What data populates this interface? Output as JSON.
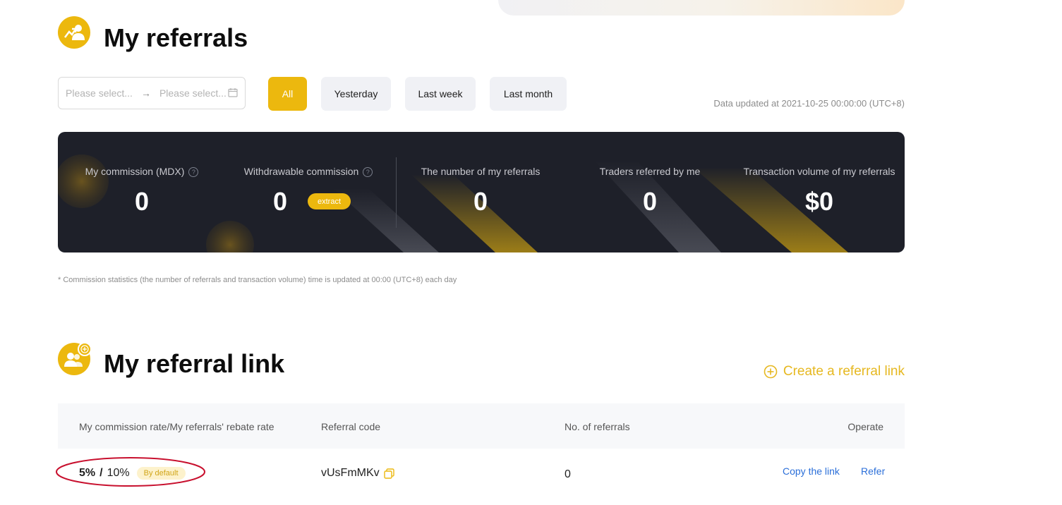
{
  "referrals": {
    "title": "My referrals",
    "date_start_placeholder": "Please select...",
    "date_end_placeholder": "Please select...",
    "arrow": "→",
    "filters": [
      {
        "label": "All",
        "active": true
      },
      {
        "label": "Yesterday",
        "active": false
      },
      {
        "label": "Last week",
        "active": false
      },
      {
        "label": "Last month",
        "active": false
      }
    ],
    "updated_text": "Data updated at 2021-10-25 00:00:00 (UTC+8)"
  },
  "stats": {
    "commission_label": "My commission (MDX)",
    "commission_value": "0",
    "withdrawable_label": "Withdrawable commission",
    "withdrawable_value": "0",
    "extract_label": "extract",
    "referrals_count_label": "The number of my referrals",
    "referrals_count_value": "0",
    "traders_label": "Traders referred by me",
    "traders_value": "0",
    "volume_label": "Transaction volume of my referrals",
    "volume_value": "$0",
    "help_glyph": "?"
  },
  "footnote": "* Commission statistics (the number of referrals and transaction volume) time is updated at 00:00 (UTC+8) each day",
  "referral_link": {
    "title": "My referral link",
    "create_label": "Create a referral link",
    "columns": [
      "My commission rate/My referrals' rebate rate",
      "Referral code",
      "No. of referrals",
      "Operate"
    ],
    "row": {
      "my_rate": "5%",
      "separator": "/",
      "referral_rate": "10%",
      "badge": "By default",
      "code": "vUsFmMKv",
      "count": "0",
      "copy_link": "Copy the link",
      "refer": "Refer"
    }
  },
  "colors": {
    "accent": "#ecb80e",
    "card_bg": "#1e2029",
    "link_blue": "#2b6fd9",
    "annotation_red": "#c8102e"
  }
}
